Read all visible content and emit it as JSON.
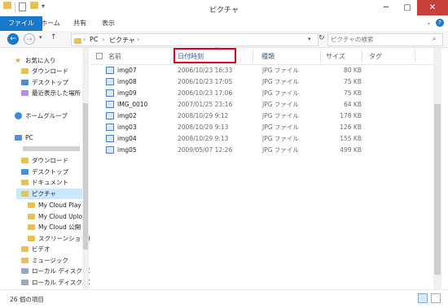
{
  "window": {
    "title": "ピクチャ"
  },
  "ribbon": {
    "tabs": [
      "ファイル",
      "ホーム",
      "共有",
      "表示"
    ]
  },
  "address": {
    "crumbs": [
      "PC",
      "ピクチャ"
    ],
    "search_placeholder": "ピクチャの検索"
  },
  "nav": {
    "favorites_label": "お気に入り",
    "favorites": [
      "ダウンロード",
      "デスクトップ",
      "最近表示した場所"
    ],
    "homegroup_label": "ホームグループ",
    "pc_label": "PC",
    "pc_items": [
      "ダウンロード",
      "デスクトップ",
      "ドキュメント",
      "ピクチャ"
    ],
    "picture_children": [
      "My Cloud Play",
      "My Cloud Uplo",
      "My Cloud 公開",
      "スクリーンショット"
    ],
    "pc_items_after": [
      "ビデオ",
      "ミュージック",
      "ローカル ディスク (C",
      "ローカル ディスク (D"
    ]
  },
  "columns": {
    "name": "名前",
    "date": "日付時刻",
    "type": "種類",
    "size": "サイズ",
    "tag": "タグ"
  },
  "files": [
    {
      "name": "img07",
      "date": "2006/10/23 16:33",
      "type": "JPG ファイル",
      "size": "80 KB"
    },
    {
      "name": "img08",
      "date": "2006/10/23 17:05",
      "type": "JPG ファイル",
      "size": "75 KB"
    },
    {
      "name": "img09",
      "date": "2006/10/23 17:06",
      "type": "JPG ファイル",
      "size": "75 KB"
    },
    {
      "name": "IMG_0010",
      "date": "2007/01/25 23:16",
      "type": "JPG ファイル",
      "size": "64 KB"
    },
    {
      "name": "img02",
      "date": "2008/10/29 9:12",
      "type": "JPG ファイル",
      "size": "178 KB"
    },
    {
      "name": "img03",
      "date": "2008/10/29 9:13",
      "type": "JPG ファイル",
      "size": "126 KB"
    },
    {
      "name": "img04",
      "date": "2008/10/29 9:13",
      "type": "JPG ファイル",
      "size": "155 KB"
    },
    {
      "name": "img05",
      "date": "2009/05/07 12:26",
      "type": "JPG ファイル",
      "size": "499 KB"
    }
  ],
  "status": {
    "item_count": "26 個の項目"
  },
  "colors": {
    "accent": "#1979ca",
    "highlight_box": "#e0001a",
    "selection": "#cce8ff",
    "close": "#c7403a"
  }
}
